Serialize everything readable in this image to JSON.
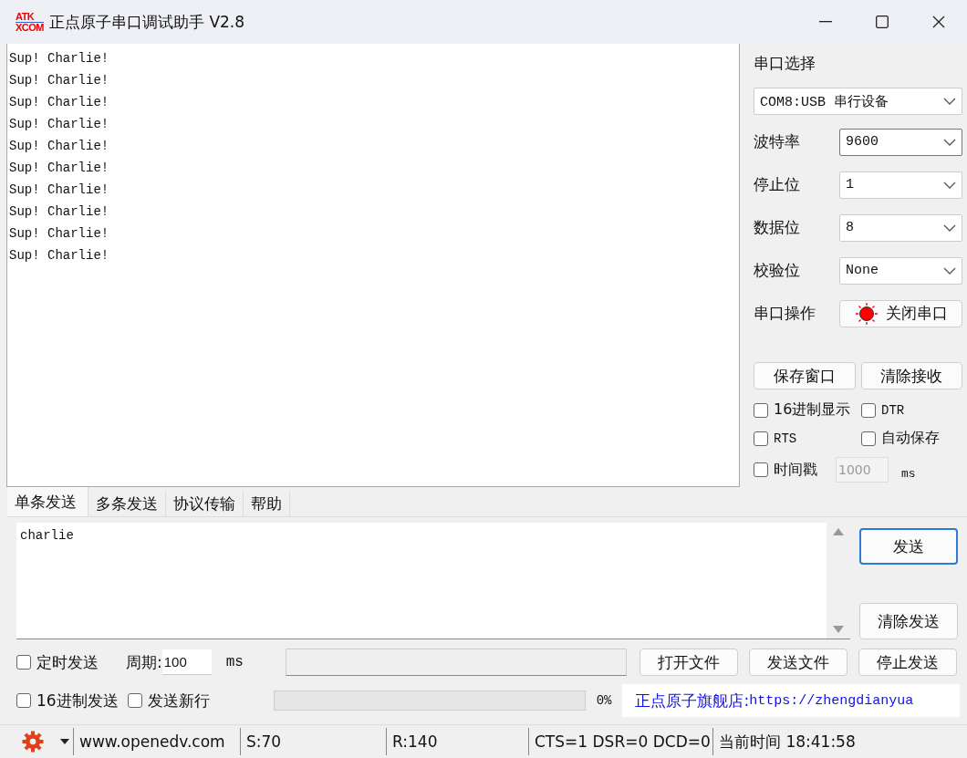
{
  "window": {
    "title": "正点原子串口调试助手 V2.8",
    "logo_top": "ATK",
    "logo_bottom": "XCOM"
  },
  "receive": {
    "lines": [
      "Sup! Charlie!",
      "Sup! Charlie!",
      "Sup! Charlie!",
      "Sup! Charlie!",
      "Sup! Charlie!",
      "Sup! Charlie!",
      "Sup! Charlie!",
      "Sup! Charlie!",
      "Sup! Charlie!",
      "Sup! Charlie!"
    ]
  },
  "settings": {
    "port_label": "串口选择",
    "port_value": "COM8:USB 串行设备",
    "fields": [
      {
        "label": "波特率",
        "value": "9600",
        "focused": true
      },
      {
        "label": "停止位",
        "value": "1",
        "focused": false
      },
      {
        "label": "数据位",
        "value": "8",
        "focused": false
      },
      {
        "label": "校验位",
        "value": "None",
        "focused": false
      }
    ],
    "action_label": "串口操作",
    "action_button": "关闭串口",
    "port_open": true,
    "buttons": [
      "保存窗口",
      "清除接收"
    ],
    "options": [
      {
        "label": "16进制显示",
        "checked": false
      },
      {
        "label": "DTR",
        "checked": false
      },
      {
        "label": "RTS",
        "checked": false
      },
      {
        "label": "自动保存",
        "checked": false
      }
    ],
    "timestamp": {
      "label": "时间戳",
      "checked": false,
      "interval": "1000",
      "unit": "ms"
    }
  },
  "tabs": [
    {
      "label": "单条发送",
      "selected": true
    },
    {
      "label": "多条发送",
      "selected": false
    },
    {
      "label": "协议传输",
      "selected": false
    },
    {
      "label": "帮助",
      "selected": false
    }
  ],
  "send": {
    "text": "charlie",
    "send_button": "发送",
    "clear_button": "清除发送"
  },
  "timed": {
    "label": "定时发送",
    "checked": false,
    "period_label": "周期:",
    "period": "100",
    "unit": "ms"
  },
  "file_buttons": [
    "打开文件",
    "发送文件",
    "停止发送"
  ],
  "hex_send": {
    "label": "16进制发送",
    "checked": false
  },
  "newline": {
    "label": "发送新行",
    "checked": false
  },
  "progress": {
    "level": 0,
    "reading": "0%"
  },
  "store": {
    "label": "正点原子旗舰店:",
    "url": "https://zhengdianyua"
  },
  "status_bar": {
    "website": "www.openedv.com",
    "sent": "S:70",
    "received": "R:140",
    "signals": "CTS=1 DSR=0 DCD=0",
    "time": "当前时间 18:41:58"
  }
}
